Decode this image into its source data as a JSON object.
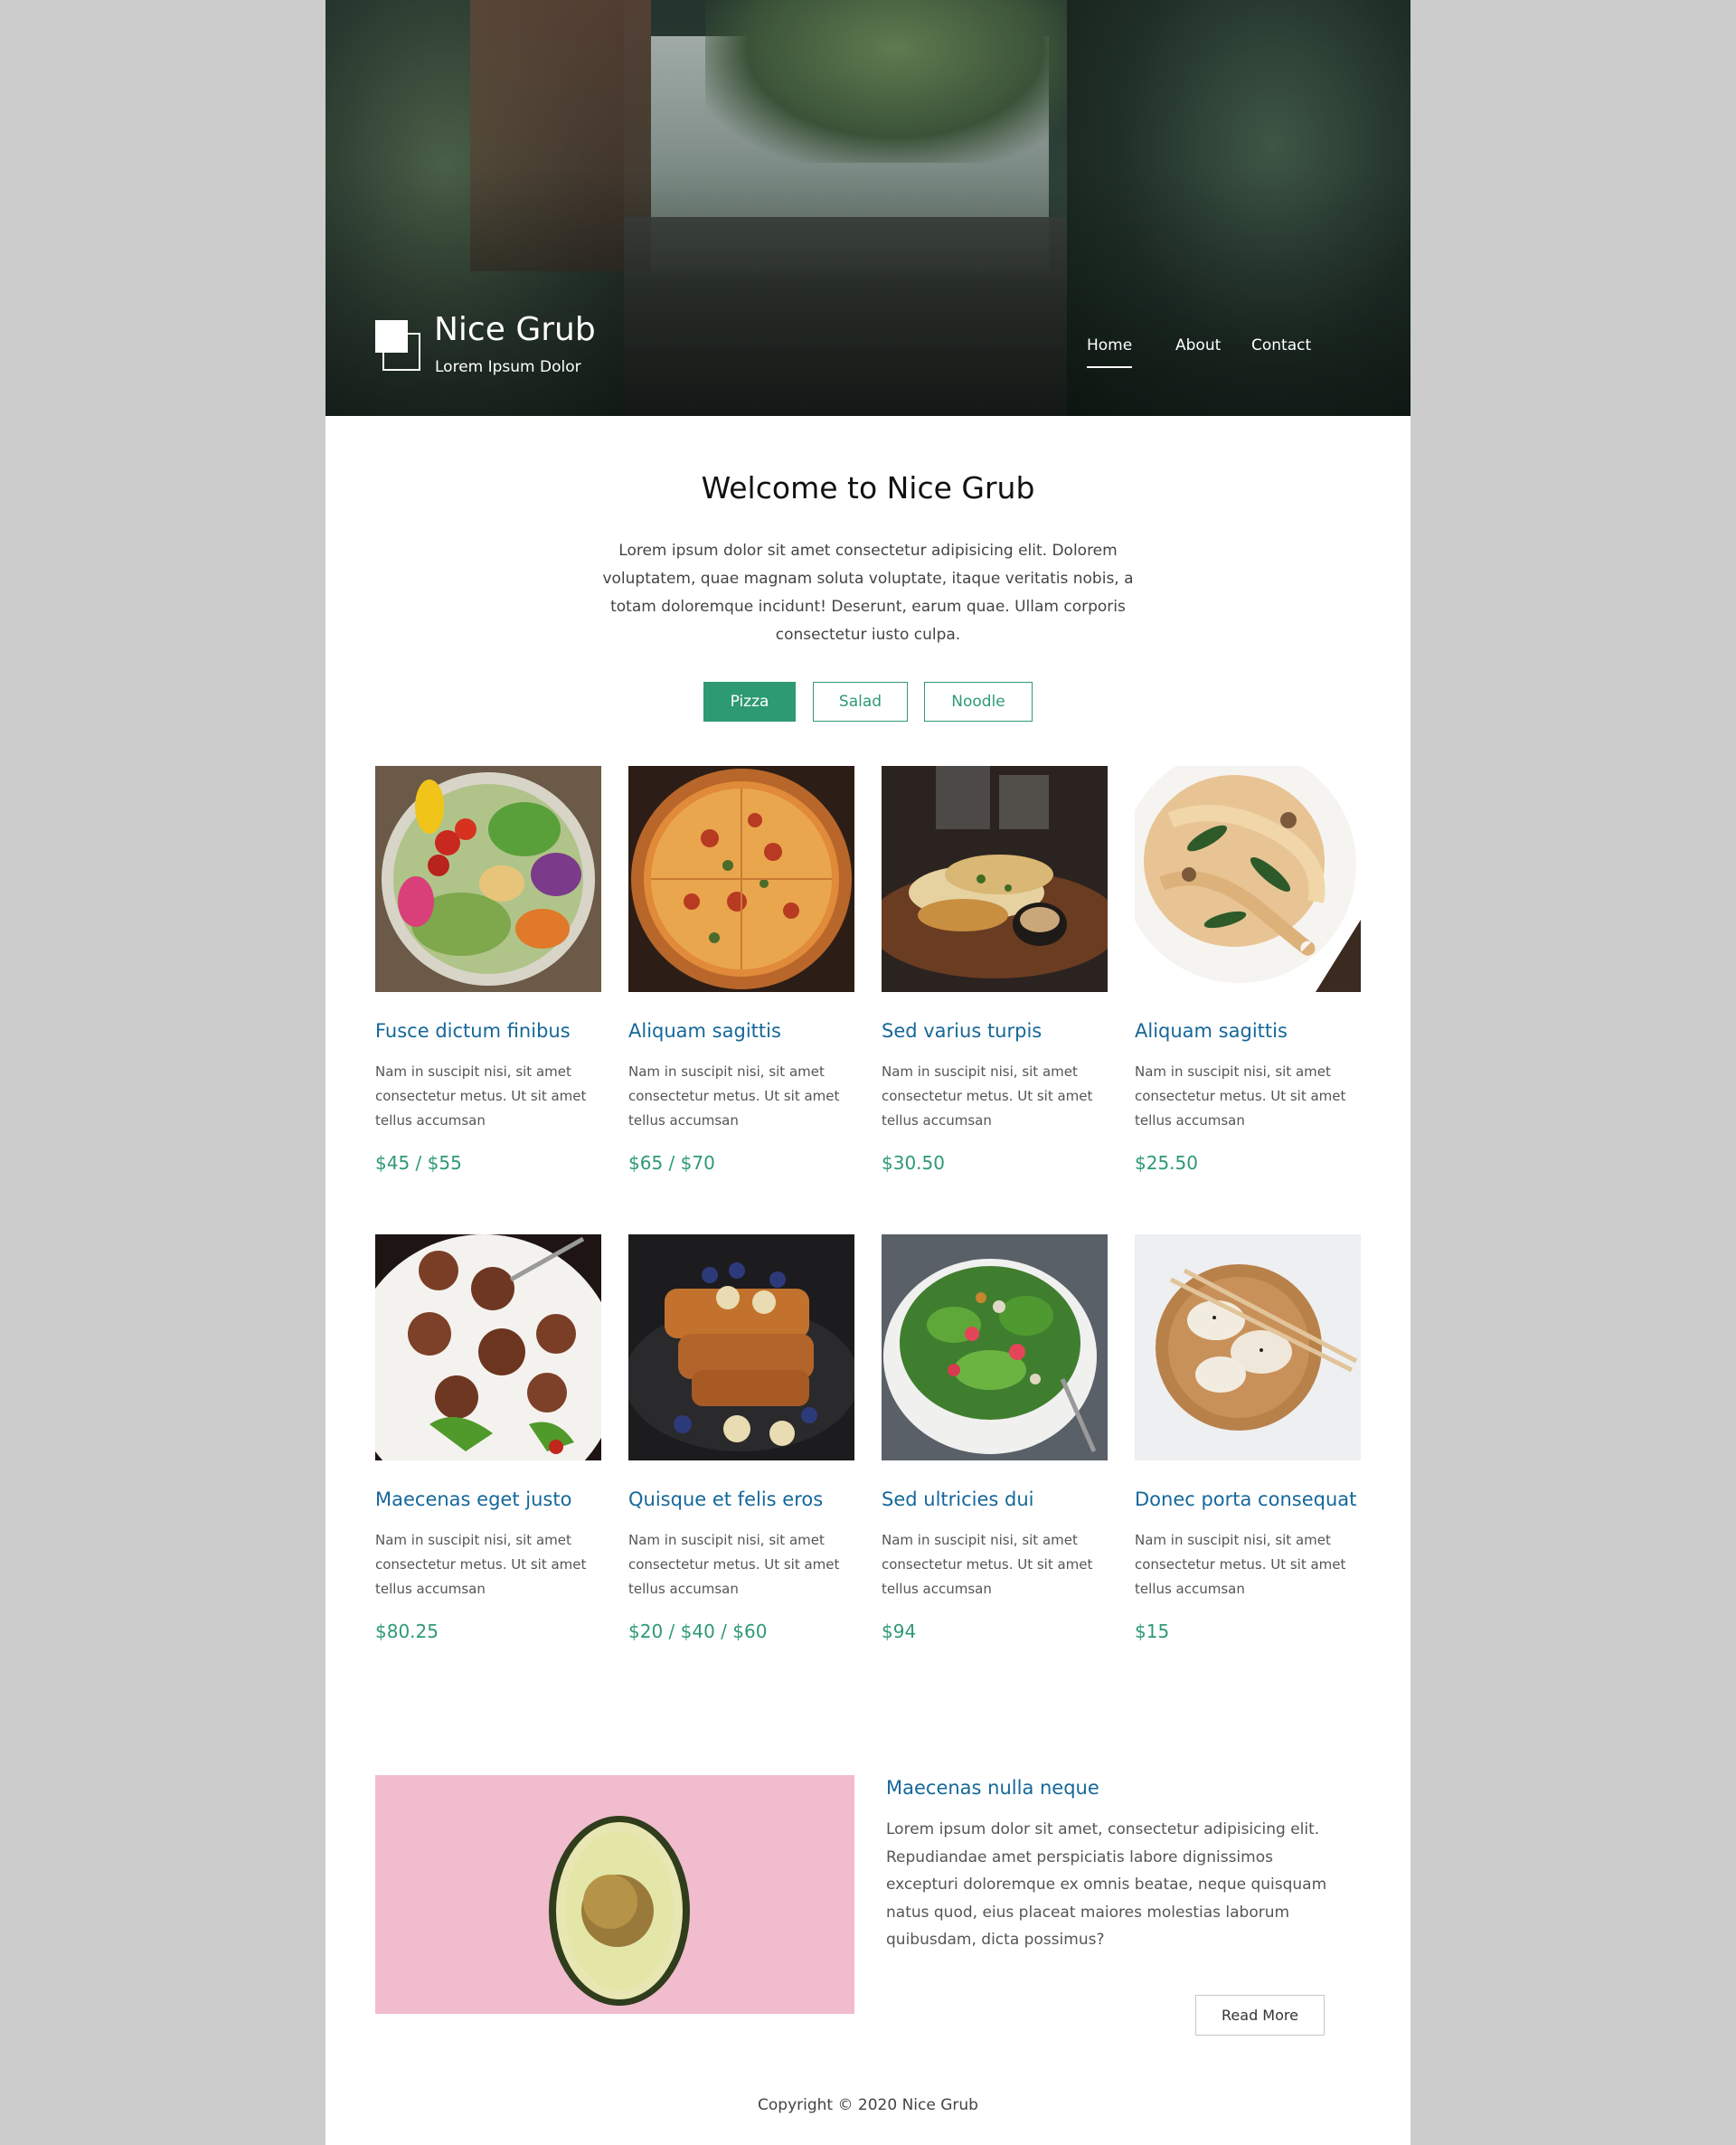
{
  "site": {
    "title": "Nice Grub",
    "tagline": "Lorem Ipsum Dolor"
  },
  "nav": {
    "items": [
      {
        "label": "Home",
        "active": true
      },
      {
        "label": "About",
        "active": false
      },
      {
        "label": "Contact",
        "active": false
      }
    ]
  },
  "welcome": {
    "title": "Welcome to Nice Grub",
    "text": "Lorem ipsum dolor sit amet consectetur adipisicing elit. Dolorem voluptatem, quae magnam soluta voluptate, itaque veritatis nobis, a totam doloremque incidunt! Deserunt, earum quae. Ullam corporis consectetur iusto culpa."
  },
  "tabs": [
    {
      "label": "Pizza",
      "active": true
    },
    {
      "label": "Salad",
      "active": false
    },
    {
      "label": "Noodle",
      "active": false
    }
  ],
  "menu": {
    "items": [
      {
        "title": "Fusce dictum finibus",
        "desc": "Nam in suscipit nisi, sit amet consectetur metus. Ut sit amet tellus accumsan",
        "price": "$45 / $55"
      },
      {
        "title": "Aliquam sagittis",
        "desc": "Nam in suscipit nisi, sit amet consectetur metus. Ut sit amet tellus accumsan",
        "price": "$65 / $70"
      },
      {
        "title": "Sed varius turpis",
        "desc": "Nam in suscipit nisi, sit amet consectetur metus. Ut sit amet tellus accumsan",
        "price": "$30.50"
      },
      {
        "title": "Aliquam sagittis",
        "desc": "Nam in suscipit nisi, sit amet consectetur metus. Ut sit amet tellus accumsan",
        "price": "$25.50"
      },
      {
        "title": "Maecenas eget justo",
        "desc": "Nam in suscipit nisi, sit amet consectetur metus. Ut sit amet tellus accumsan",
        "price": "$80.25"
      },
      {
        "title": "Quisque et felis eros",
        "desc": "Nam in suscipit nisi, sit amet consectetur metus. Ut sit amet tellus accumsan",
        "price": "$20 / $40 / $60"
      },
      {
        "title": "Sed ultricies dui",
        "desc": "Nam in suscipit nisi, sit amet consectetur metus. Ut sit amet tellus accumsan",
        "price": "$94"
      },
      {
        "title": "Donec porta consequat",
        "desc": "Nam in suscipit nisi, sit amet consectetur metus. Ut sit amet tellus accumsan",
        "price": "$15"
      }
    ]
  },
  "feature": {
    "title": "Maecenas nulla neque",
    "text": "Lorem ipsum dolor sit amet, consectetur adipisicing elit. Repudiandae amet perspiciatis labore dignissimos excepturi doloremque ex omnis beatae, neque quisquam natus quod, eius placeat maiores molestias laborum quibusdam, dicta possimus?",
    "button_label": "Read More"
  },
  "footer": {
    "copyright": "Copyright © 2020 Nice Grub"
  },
  "colors": {
    "accent": "#2e9a72",
    "title_blue": "#15679a",
    "page_bg": "#cccccc"
  }
}
